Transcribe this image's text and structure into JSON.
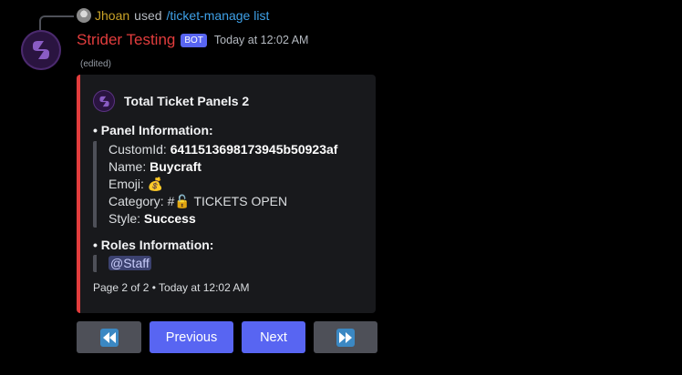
{
  "reply": {
    "username": "Jhoan",
    "used_text": "used",
    "command": "/ticket-manage list"
  },
  "message": {
    "username": "Strider Testing",
    "bot_tag": "BOT",
    "timestamp": "Today at 12:02 AM",
    "edited": "(edited)"
  },
  "embed": {
    "accent_color": "#e23d3d",
    "author": "Total Ticket Panels 2",
    "panel_section": {
      "title": "• Panel Information:",
      "custom_id_label": "CustomId: ",
      "custom_id_value": "6411513698173945b50923af",
      "name_label": "Name: ",
      "name_value": "Buycraft",
      "emoji_label": "Emoji: ",
      "emoji_value": "💰",
      "category_label": "Category: ",
      "category_value": "#🔓 TICKETS OPEN",
      "style_label": "Style: ",
      "style_value": "Success"
    },
    "roles_section": {
      "title": "• Roles Information:",
      "role_mention": "@Staff"
    },
    "footer": "Page 2 of 2 • Today at 12:02 AM"
  },
  "buttons": {
    "first_icon": "rewind-icon",
    "previous_label": "Previous",
    "next_label": "Next",
    "last_icon": "fast-forward-icon",
    "primary_color": "#5865f2",
    "secondary_color": "#4e5058"
  }
}
